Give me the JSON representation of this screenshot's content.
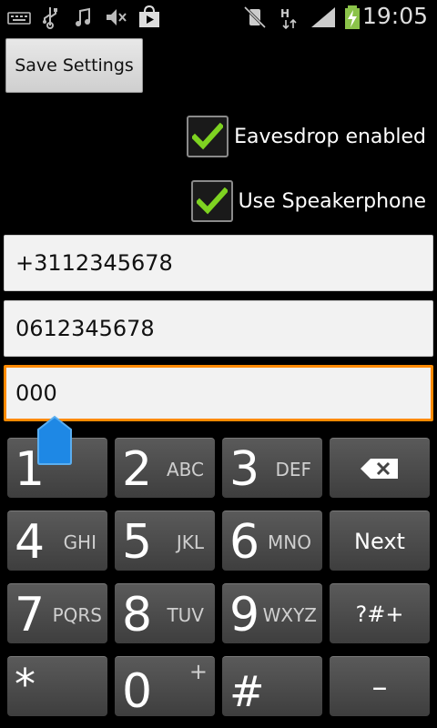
{
  "status_bar": {
    "time": "19:05",
    "icons": [
      "keyboard-icon",
      "usb-icon",
      "music-icon",
      "mute-icon",
      "play-store-icon",
      "vibrate-off-icon",
      "hsdpa-icon",
      "signal-icon",
      "battery-charging-icon"
    ]
  },
  "save_button": {
    "label": "Save Settings"
  },
  "checkboxes": [
    {
      "label": "Eavesdrop enabled",
      "checked": true
    },
    {
      "label": "Use Speakerphone",
      "checked": true
    }
  ],
  "inputs": [
    {
      "value": "+3112345678"
    },
    {
      "value": "0612345678"
    },
    {
      "value": "000"
    }
  ],
  "keypad": {
    "keys": [
      {
        "digit": "1",
        "letters": ""
      },
      {
        "digit": "2",
        "letters": "ABC"
      },
      {
        "digit": "3",
        "letters": "DEF"
      },
      {
        "label": "backspace"
      },
      {
        "digit": "4",
        "letters": "GHI"
      },
      {
        "digit": "5",
        "letters": "JKL"
      },
      {
        "digit": "6",
        "letters": "MNO"
      },
      {
        "label": "Next"
      },
      {
        "digit": "7",
        "letters": "PQRS"
      },
      {
        "digit": "8",
        "letters": "TUV"
      },
      {
        "digit": "9",
        "letters": "WXYZ"
      },
      {
        "label": "?#+"
      },
      {
        "digit": "*",
        "letters": ""
      },
      {
        "digit": "0",
        "letters": "+"
      },
      {
        "digit": "#",
        "letters": ""
      },
      {
        "label": "–"
      }
    ]
  },
  "colors": {
    "focus_border": "#ff8a00",
    "check_green": "#7ed321",
    "handle_blue": "#1e88e5"
  }
}
